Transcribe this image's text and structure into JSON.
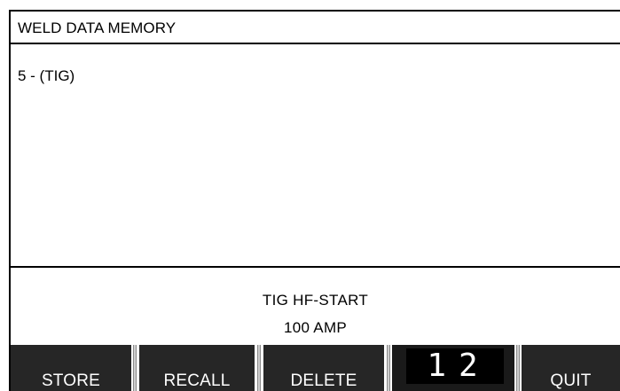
{
  "header": {
    "title": "WELD DATA MEMORY"
  },
  "memory_list": {
    "items": [
      {
        "label": "5 - (TIG)"
      }
    ]
  },
  "info": {
    "method": "TIG HF-START",
    "current": "100 AMP"
  },
  "softkeys": {
    "store": "STORE",
    "recall": "RECALL",
    "delete": "DELETE",
    "page_current": "1",
    "page_total": "2",
    "quit": "QUIT"
  },
  "colors": {
    "background": "#ffffff",
    "softkey_bg": "#262626",
    "text": "#000000"
  }
}
